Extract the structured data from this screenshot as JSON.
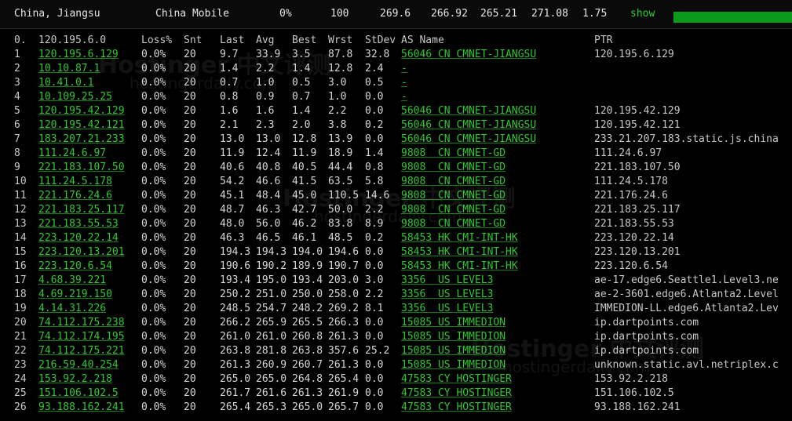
{
  "header": {
    "location": "China, Jiangsu",
    "isp": "China Mobile",
    "loss": "0%",
    "count": "100",
    "v1": "269.6",
    "v2": "266.92",
    "v3": "265.21",
    "v4": "271.08",
    "v5": "1.75",
    "show_label": "show",
    "accent_color": "#0b9a1c"
  },
  "table": {
    "columns": [
      "0.",
      "120.195.6.0",
      "Loss%",
      "Snt",
      "Last",
      "Avg",
      "Best",
      "Wrst",
      "StDev",
      "AS Name",
      "PTR"
    ],
    "rows": [
      [
        "1",
        "120.195.6.129",
        "0.0%",
        "20",
        "9.7",
        "33.9",
        "3.5",
        "87.8",
        "32.8",
        "56046 CN CMNET-JIANGSU",
        "120.195.6.129"
      ],
      [
        "2",
        "10.10.87.1",
        "0.0%",
        "20",
        "1.4",
        "2.2",
        "1.4",
        "12.8",
        "2.4",
        "-",
        ""
      ],
      [
        "3",
        "10.41.0.1",
        "0.0%",
        "20",
        "0.7",
        "1.0",
        "0.5",
        "3.0",
        "0.5",
        "-",
        ""
      ],
      [
        "4",
        "10.109.25.25",
        "0.0%",
        "20",
        "0.8",
        "0.9",
        "0.7",
        "1.0",
        "0.0",
        "-",
        ""
      ],
      [
        "5",
        "120.195.42.129",
        "0.0%",
        "20",
        "1.6",
        "1.6",
        "1.4",
        "2.2",
        "0.0",
        "56046 CN CMNET-JIANGSU",
        "120.195.42.129"
      ],
      [
        "6",
        "120.195.42.121",
        "0.0%",
        "20",
        "2.1",
        "2.3",
        "2.0",
        "3.8",
        "0.2",
        "56046 CN CMNET-JIANGSU",
        "120.195.42.121"
      ],
      [
        "7",
        "183.207.21.233",
        "0.0%",
        "20",
        "13.0",
        "13.0",
        "12.8",
        "13.9",
        "0.0",
        "56046 CN CMNET-JIANGSU",
        "233.21.207.183.static.js.china"
      ],
      [
        "8",
        "111.24.6.97",
        "0.0%",
        "20",
        "11.9",
        "12.4",
        "11.9",
        "18.9",
        "1.4",
        "9808  CN CMNET-GD",
        "111.24.6.97"
      ],
      [
        "9",
        "221.183.107.50",
        "0.0%",
        "20",
        "40.6",
        "40.8",
        "40.5",
        "44.4",
        "0.8",
        "9808  CN CMNET-GD",
        "221.183.107.50"
      ],
      [
        "10",
        "111.24.5.178",
        "0.0%",
        "20",
        "54.2",
        "46.6",
        "41.5",
        "63.5",
        "5.8",
        "9808  CN CMNET-GD",
        "111.24.5.178"
      ],
      [
        "11",
        "221.176.24.6",
        "0.0%",
        "20",
        "45.1",
        "48.4",
        "45.0",
        "110.5",
        "14.6",
        "9808  CN CMNET-GD",
        "221.176.24.6"
      ],
      [
        "12",
        "221.183.25.117",
        "0.0%",
        "20",
        "48.7",
        "46.3",
        "42.7",
        "50.0",
        "2.2",
        "9808  CN CMNET-GD",
        "221.183.25.117"
      ],
      [
        "13",
        "221.183.55.53",
        "0.0%",
        "20",
        "48.0",
        "56.0",
        "46.2",
        "83.8",
        "8.9",
        "9808  CN CMNET-GD",
        "221.183.55.53"
      ],
      [
        "14",
        "223.120.22.14",
        "0.0%",
        "20",
        "46.3",
        "46.5",
        "46.1",
        "48.5",
        "0.2",
        "58453 HK CMI-INT-HK",
        "223.120.22.14"
      ],
      [
        "15",
        "223.120.13.201",
        "0.0%",
        "20",
        "194.3",
        "194.3",
        "194.0",
        "194.6",
        "0.0",
        "58453 HK CMI-INT-HK",
        "223.120.13.201"
      ],
      [
        "16",
        "223.120.6.54",
        "0.0%",
        "20",
        "190.6",
        "190.2",
        "189.9",
        "190.7",
        "0.0",
        "58453 HK CMI-INT-HK",
        "223.120.6.54"
      ],
      [
        "17",
        "4.68.39.221",
        "0.0%",
        "20",
        "193.4",
        "195.0",
        "193.4",
        "203.0",
        "3.0",
        "3356  US LEVEL3",
        "ae-17.edge6.Seattle1.Level3.ne"
      ],
      [
        "18",
        "4.69.219.150",
        "0.0%",
        "20",
        "250.2",
        "251.0",
        "250.0",
        "258.0",
        "2.2",
        "3356  US LEVEL3",
        "ae-2-3601.edge6.Atlanta2.Level"
      ],
      [
        "19",
        "4.14.31.226",
        "0.0%",
        "20",
        "248.5",
        "254.7",
        "248.2",
        "269.2",
        "8.1",
        "3356  US LEVEL3",
        "IMMEDION-LL.edge6.Atlanta2.Lev"
      ],
      [
        "20",
        "74.112.175.238",
        "0.0%",
        "20",
        "266.2",
        "265.9",
        "265.5",
        "266.3",
        "0.0",
        "15085 US IMMEDION",
        "ip.dartpoints.com"
      ],
      [
        "21",
        "74.112.174.195",
        "0.0%",
        "20",
        "261.0",
        "261.0",
        "260.8",
        "261.3",
        "0.0",
        "15085 US IMMEDION",
        "ip.dartpoints.com"
      ],
      [
        "22",
        "74.112.175.221",
        "0.0%",
        "20",
        "263.8",
        "281.8",
        "263.8",
        "357.6",
        "25.2",
        "15085 US IMMEDION",
        "ip.dartpoints.com"
      ],
      [
        "23",
        "216.59.40.254",
        "0.0%",
        "20",
        "261.3",
        "260.9",
        "260.7",
        "261.3",
        "0.0",
        "15085 US IMMEDION",
        "unknown.static.avl.netriplex.c"
      ],
      [
        "24",
        "153.92.2.218",
        "0.0%",
        "20",
        "265.0",
        "265.0",
        "264.8",
        "265.4",
        "0.0",
        "47583 CY HOSTINGER",
        "153.92.2.218"
      ],
      [
        "25",
        "151.106.102.5",
        "0.0%",
        "20",
        "261.7",
        "261.6",
        "261.3",
        "261.9",
        "0.0",
        "47583 CY HOSTINGER",
        "151.106.102.5"
      ],
      [
        "26",
        "93.188.162.241",
        "0.0%",
        "20",
        "265.4",
        "265.3",
        "265.0",
        "265.7",
        "0.0",
        "47583 CY HOSTINGER",
        "93.188.162.241"
      ]
    ]
  },
  "watermark": {
    "brand": "Hostinger 中文评测",
    "url": "hostingerdaily.com"
  }
}
